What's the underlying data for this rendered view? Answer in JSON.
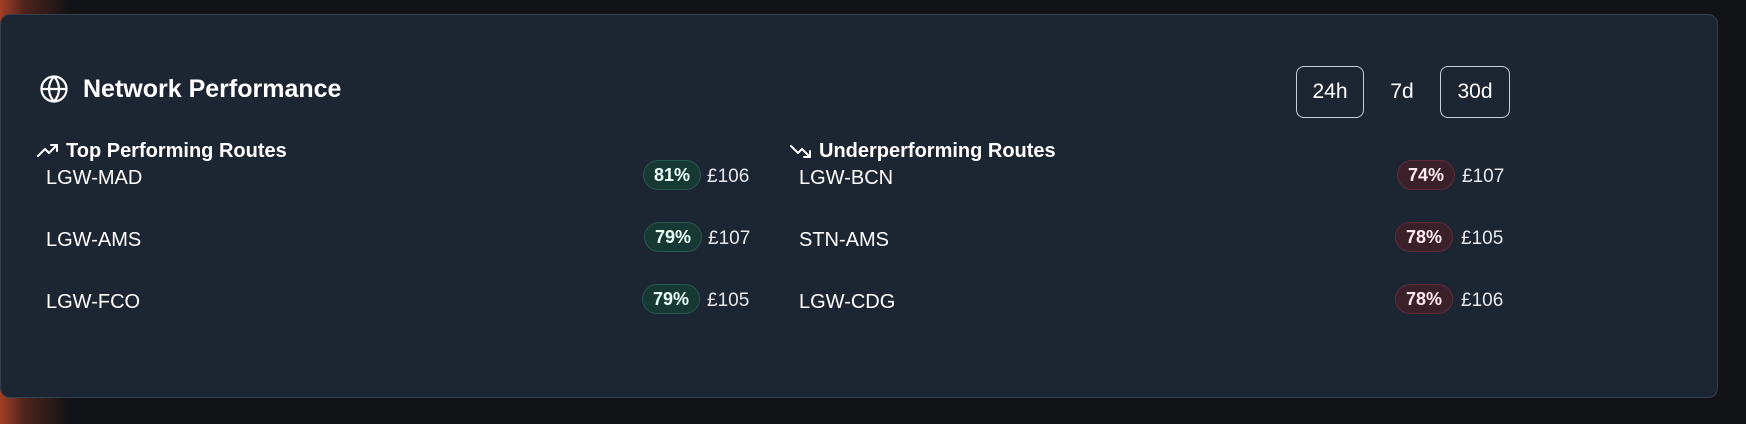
{
  "panel": {
    "title": "Network Performance",
    "title_icon": "globe-icon",
    "ranges": [
      "24h",
      "7d",
      "30d"
    ]
  },
  "top": {
    "heading": "Top Performing Routes",
    "icon": "trending-up-icon",
    "routes": [
      {
        "name": "LGW-MAD",
        "percent": "81%",
        "price": "£106"
      },
      {
        "name": "LGW-AMS",
        "percent": "79%",
        "price": "£107"
      },
      {
        "name": "LGW-FCO",
        "percent": "79%",
        "price": "£105"
      }
    ]
  },
  "under": {
    "heading": "Underperforming Routes",
    "icon": "trending-down-icon",
    "routes": [
      {
        "name": "LGW-BCN",
        "percent": "74%",
        "price": "£107"
      },
      {
        "name": "STN-AMS",
        "percent": "78%",
        "price": "£105"
      },
      {
        "name": "LGW-CDG",
        "percent": "78%",
        "price": "£106"
      }
    ]
  },
  "colors": {
    "good_badge": "#163a33",
    "bad_badge": "#3a2029",
    "card_bg": "#1c2532"
  }
}
